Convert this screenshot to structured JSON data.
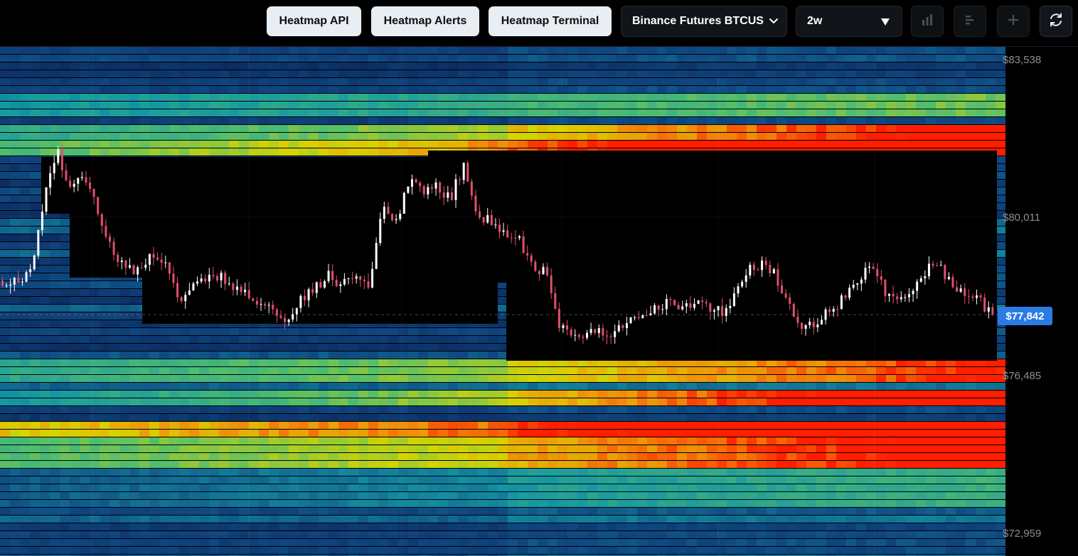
{
  "toolbar": {
    "buttons": {
      "api": "Heatmap API",
      "alerts": "Heatmap Alerts",
      "terminal": "Heatmap Terminal"
    },
    "exchange_select": "Binance Futures BTCUS",
    "timeframe_select": "2w",
    "icons": [
      "bar-chart-icon",
      "align-left-icon",
      "plus-icon",
      "refresh-icon"
    ]
  },
  "price_axis": {
    "labels": [
      "$83,538",
      "$80,011",
      "$76,485",
      "$72,959"
    ],
    "current_price": "$77,842"
  },
  "colors": {
    "background": "#000000",
    "current_price_badge": "#2b7be4",
    "candle_up": "#ffffff",
    "candle_down": "#e0506a",
    "heat_low": "#0a1a3f",
    "heat_mid": "#13a0a8",
    "heat_high": "#d8d400",
    "heat_max": "#ff2000"
  },
  "chart_data": {
    "type": "heatmap",
    "title": "",
    "y_axis_ticks": [
      83538,
      80011,
      76485,
      72959
    ],
    "current_price": 77842,
    "candles_approx_close_path": [
      78600,
      78550,
      78700,
      80300,
      81500,
      80700,
      80900,
      80200,
      79300,
      78900,
      78800,
      79200,
      79000,
      78100,
      78400,
      78600,
      78700,
      78500,
      78300,
      78100,
      78000,
      77700,
      78200,
      78400,
      78700,
      78500,
      78600,
      78400,
      80300,
      79900,
      80900,
      80500,
      80700,
      80400,
      81200,
      80100,
      79900,
      79700,
      79600,
      78900,
      78800,
      77600,
      77300,
      77400,
      77500,
      77400,
      77600,
      77800,
      78000,
      78100,
      78000,
      78100,
      78000,
      77900,
      78300,
      78900,
      79000,
      78700,
      78000,
      77600,
      77700,
      77900,
      78200,
      78600,
      79000,
      78400,
      78300,
      78200,
      78800,
      79000,
      78500,
      78300,
      78200,
      77800
    ]
  }
}
